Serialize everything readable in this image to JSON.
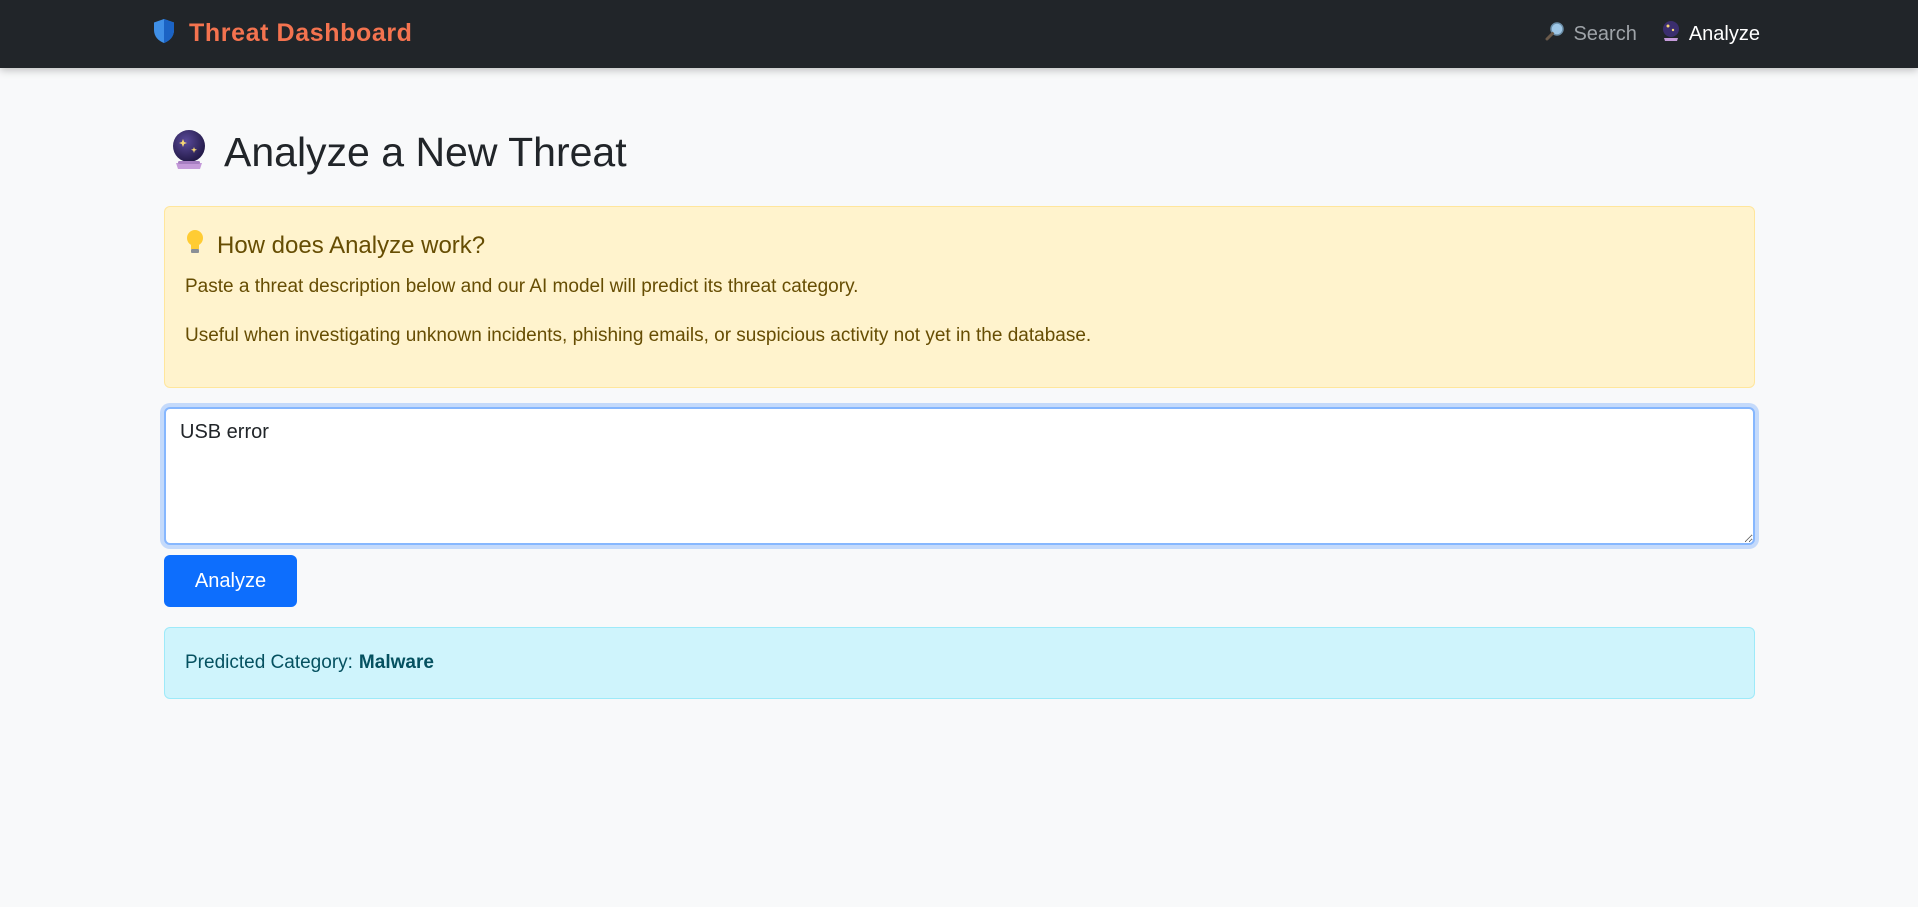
{
  "navbar": {
    "brand_icon": "shield-icon",
    "brand_text": "Threat Dashboard",
    "links": [
      {
        "label": "Search",
        "icon": "magnifier-icon",
        "active": false
      },
      {
        "label": "Analyze",
        "icon": "crystal-ball-icon",
        "active": true
      }
    ]
  },
  "page": {
    "title_icon": "crystal-ball-icon",
    "title": "Analyze a New Threat"
  },
  "info": {
    "icon": "lightbulb-icon",
    "heading": "How does Analyze work?",
    "p1": "Paste a threat description below and our AI model will predict its threat category.",
    "p2": "Useful when investigating unknown incidents, phishing emails, or suspicious activity not yet in the database."
  },
  "form": {
    "textarea_value": "USB error",
    "button_label": "Analyze"
  },
  "result": {
    "label": "Predicted Category:",
    "value": "Malware"
  },
  "colors": {
    "navbar_bg": "#212529",
    "brand": "#f4734f",
    "primary": "#0d6efd",
    "warning_bg": "#fff3cd",
    "info_bg": "#cff4fc"
  }
}
